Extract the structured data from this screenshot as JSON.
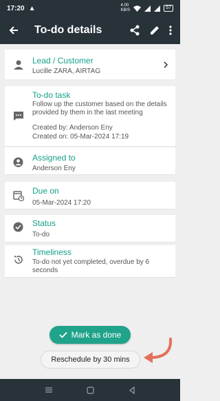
{
  "status_bar": {
    "time": "17:20",
    "warning": "▲",
    "net": "4.00\nKB/S",
    "battery": "57"
  },
  "app_bar": {
    "title": "To-do details"
  },
  "lead": {
    "label": "Lead / Customer",
    "value": "Lucille ZARA, AIRTAG"
  },
  "task": {
    "label": "To-do task",
    "description": "Follow up the customer based on the details provided by them in the last meeting",
    "created_by": "Created by: Anderson Eny",
    "created_on": "Created on: 05-Mar-2024 17:19"
  },
  "assigned": {
    "label": "Assigned to",
    "value": "Anderson Eny"
  },
  "due": {
    "label": "Due on",
    "value": "05-Mar-2024 17:20"
  },
  "status": {
    "label": "Status",
    "value": "To-do"
  },
  "timeliness": {
    "label": "Timeliness",
    "value": "To-do not yet completed, overdue by 6 seconds"
  },
  "actions": {
    "mark_done": "Mark as done",
    "reschedule": "Reschedule by 30 mins"
  },
  "colors": {
    "accent": "#14a089",
    "bar": "#273239",
    "arrow": "#e2705a"
  }
}
